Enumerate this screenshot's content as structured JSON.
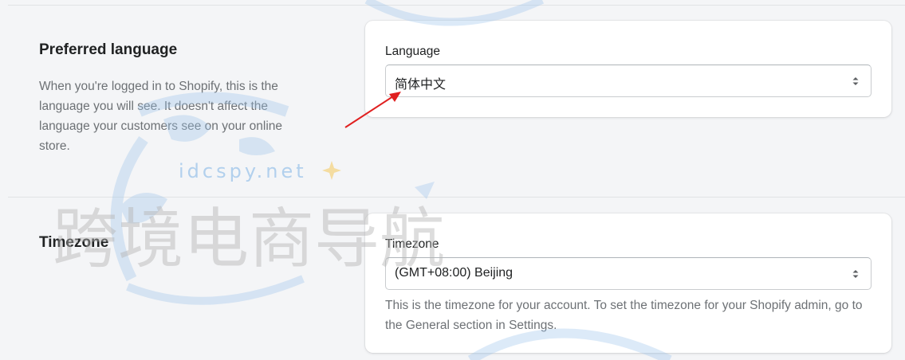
{
  "language_section": {
    "heading": "Preferred language",
    "description": "When you're logged in to Shopify, this is the language you will see. It doesn't affect the language your customers see on your online store.",
    "field_label": "Language",
    "selected_value": "简体中文"
  },
  "timezone_section": {
    "heading": "Timezone",
    "field_label": "Timezone",
    "selected_value": "(GMT+08:00) Beijing",
    "help_text": "This is the timezone for your account. To set the timezone for your Shopify admin, go to the General section in Settings."
  },
  "watermark": {
    "url_text": "idcspy.net",
    "title_text": "跨境电商导航"
  },
  "colors": {
    "annotation_arrow": "#e02020",
    "watermark_blue": "#9cc4ea",
    "watermark_gray": "#b4b4b4"
  },
  "icons": {
    "select_arrows": "select-arrows-icon",
    "annotation": "red-arrow-icon",
    "watermark_star": "sparkle-icon"
  }
}
